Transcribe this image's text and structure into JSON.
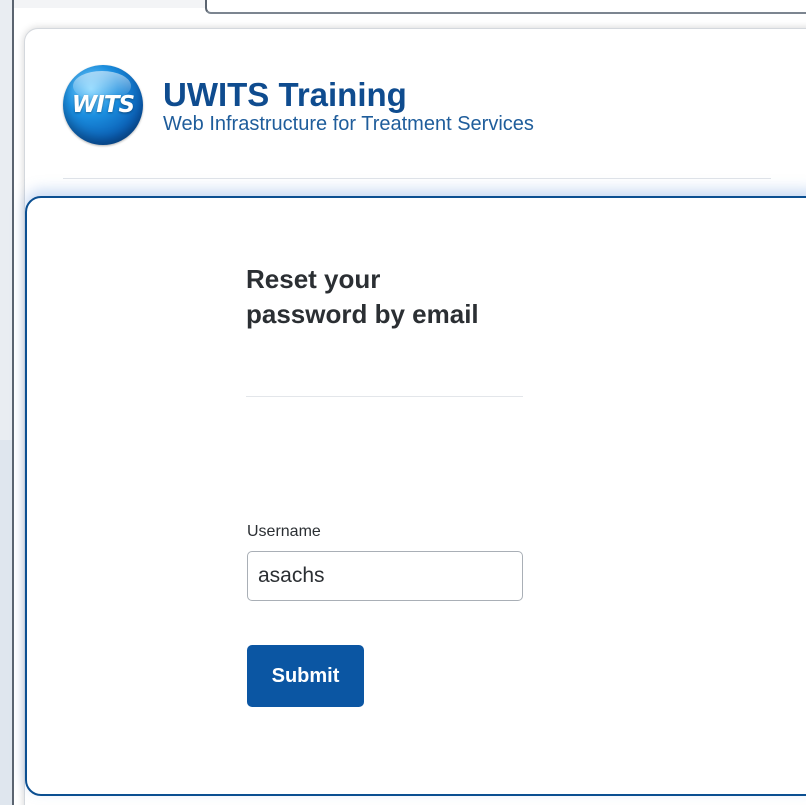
{
  "app": {
    "logo_text": "WITS",
    "title": "UWITS Training",
    "subtitle": "Web Infrastructure for Treatment Services"
  },
  "form": {
    "heading": "Reset your password by email",
    "username_label": "Username",
    "username_value": "asachs",
    "submit_label": "Submit"
  },
  "colors": {
    "brand_blue": "#0f4c8f",
    "button_blue": "#0b56a3",
    "card_border": "#0b4f91"
  }
}
